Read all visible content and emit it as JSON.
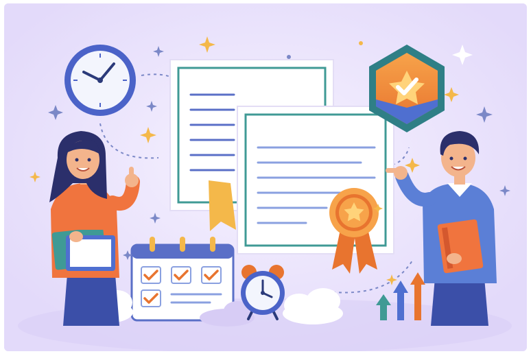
{
  "scene": {
    "background_color": "#ece6fb",
    "accent_purple": "#b8a6ec",
    "accent_orange": "#f08a3c",
    "accent_blue": "#4f6fd0",
    "accent_teal": "#3f9a95",
    "gold": "#f4b84a",
    "icons": [
      "wall-clock-icon",
      "hexagon-star-check-badge-icon",
      "certificate-document-icon",
      "award-ribbon-icon",
      "calendar-checklist-icon",
      "alarm-clock-icon",
      "growth-arrows-icon",
      "sparkle-icon",
      "cloud-icon"
    ],
    "people": [
      "woman-holding-books-thumbs-up",
      "man-holding-book-pointing"
    ]
  }
}
